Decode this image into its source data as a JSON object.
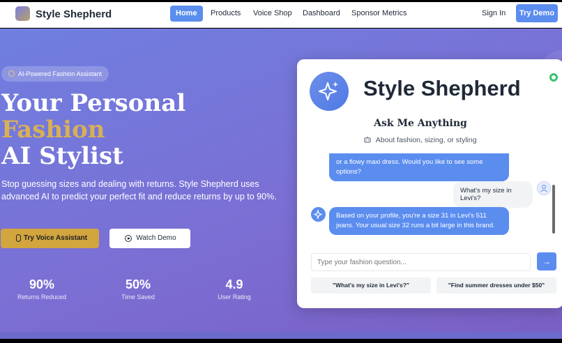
{
  "nav": {
    "brand": "Style Shepherd",
    "links": [
      "Home",
      "Products",
      "Voice Shop",
      "Dashboard",
      "Sponsor Metrics"
    ],
    "active": "Home",
    "signin": "Sign In",
    "try_demo": "Try Demo"
  },
  "hero": {
    "badge": "AI-Powered Fashion Assistant",
    "title_line1": "Your Personal",
    "title_line2": "Fashion",
    "title_line3": "AI Stylist",
    "subtitle": "Stop guessing sizes and dealing with returns. Style Shepherd uses advanced AI to predict your perfect fit and reduce returns by up to 90%.",
    "btn_voice": "Try Voice Assistant",
    "btn_watch": "Watch Demo",
    "stats": [
      {
        "value": "90%",
        "label": "Returns Reduced"
      },
      {
        "value": "50%",
        "label": "Time Saved"
      },
      {
        "value": "4.9",
        "label": "User Rating"
      }
    ]
  },
  "assistant": {
    "title": "Style Shepherd",
    "ask": "Ask Me Anything",
    "about": "About fashion, sizing, or styling",
    "messages": [
      {
        "from": "bot",
        "text": "or a flowy maxi dress. Would you like to see some options?"
      },
      {
        "from": "user",
        "text": "What's my size in Levi's?"
      },
      {
        "from": "bot",
        "text": "Based on your profile, you're a size 31 in Levi's 511 jeans. Your usual size 32 runs a bit large in this brand."
      }
    ],
    "input_placeholder": "Type your fashion question...",
    "send_label": "→",
    "suggestions": [
      "\"What's my size in Levi's?\"",
      "\"Find summer dresses under $50\""
    ]
  },
  "colors": {
    "accent": "#5b8def",
    "gold": "#d8b056",
    "online": "#38c172"
  }
}
